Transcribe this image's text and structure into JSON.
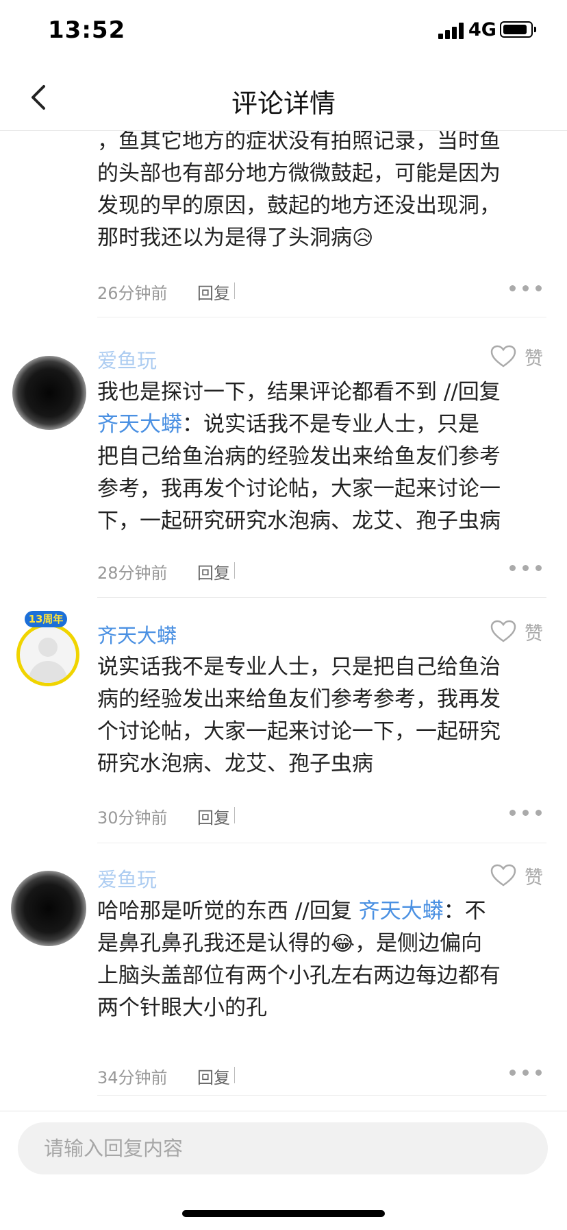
{
  "status_bar": {
    "time": "13:52",
    "network": "4G"
  },
  "nav": {
    "title": "评论详情"
  },
  "top_comment": {
    "text_lines": [
      "，鱼其它地方的症状没有拍照记录，当时鱼",
      "的头部也有部分地方微微鼓起，可能是因为",
      "发现的早的原因，鼓起的地方还没出现洞，",
      "那时我还以为是得了头洞病"
    ],
    "emoji": "😥",
    "time": "26分钟前",
    "reply_label": "回复"
  },
  "comments": [
    {
      "username": "爱鱼玩",
      "like_label": "赞",
      "text_lines": [
        "我也是探讨一下，结果评论都看不到 //回复",
        "齐天大蟒：说实话我不是专业人士，只是",
        "把自己给鱼治病的经验发出来给鱼友们参考",
        "参考，我再发个讨论帖，大家一起来讨论一",
        "下，一起研究研究水泡病、龙艾、孢子虫病"
      ],
      "mention": "齐天大蟒",
      "time": "28分钟前",
      "reply_label": "回复"
    },
    {
      "username": "齐天大蟒",
      "badge": "13周年",
      "like_label": "赞",
      "text_lines": [
        "说实话我不是专业人士，只是把自己给鱼治",
        "病的经验发出来给鱼友们参考参考，我再发",
        "个讨论帖，大家一起来讨论一下，一起研究",
        "研究水泡病、龙艾、孢子虫病"
      ],
      "time": "30分钟前",
      "reply_label": "回复"
    },
    {
      "username": "爱鱼玩",
      "like_label": "赞",
      "text_parts": {
        "l1a": "哈哈那是听觉的东西 //回复 ",
        "mention": "齐天大蟒",
        "l1b": "：不",
        "l2a": "是鼻孔鼻孔我还是认得的",
        "emoji": "😂",
        "l2b": "，是侧边偏向",
        "l3": "上脑头盖部位有两个小孔左右两边每边都有",
        "l4": "两个针眼大小的孔"
      },
      "time": "34分钟前",
      "reply_label": "回复"
    }
  ],
  "input": {
    "placeholder": "请输入回复内容"
  }
}
